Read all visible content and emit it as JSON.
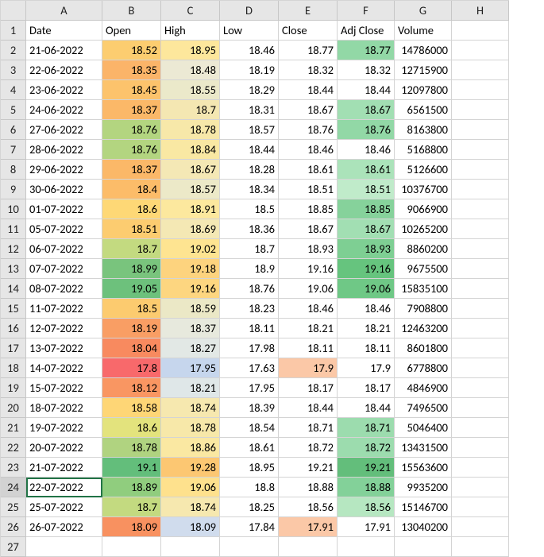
{
  "columns": [
    "A",
    "B",
    "C",
    "D",
    "E",
    "F",
    "G",
    "H"
  ],
  "row_count": 27,
  "selected_row_header": 24,
  "headers": {
    "date": "Date",
    "open": "Open",
    "high": "High",
    "low": "Low",
    "close": "Close",
    "adjclose": "Adj Close",
    "volume": "Volume"
  },
  "chart_data": {
    "type": "table",
    "title": "",
    "columns": [
      "Date",
      "Open",
      "High",
      "Low",
      "Close",
      "Adj Close",
      "Volume"
    ],
    "rows": [
      {
        "date": "21-06-2022",
        "open": 18.52,
        "open_bg": "#fccd70",
        "high": 18.95,
        "high_bg": "#fde79c",
        "low": 18.46,
        "close": 18.77,
        "adjclose": 18.77,
        "adj_bg": "#92d8a6",
        "volume": 14786000
      },
      {
        "date": "22-06-2022",
        "open": 18.35,
        "open_bg": "#fbb469",
        "high": 18.48,
        "high_bg": "#ece9d4",
        "low": 18.19,
        "close": 18.32,
        "adjclose": 18.32,
        "adj_bg": "#ffffff",
        "volume": 12715900
      },
      {
        "date": "23-06-2022",
        "open": 18.45,
        "open_bg": "#fcc36c",
        "high": 18.55,
        "high_bg": "#ebe9ca",
        "low": 18.29,
        "close": 18.44,
        "adjclose": 18.44,
        "adj_bg": "#ffffff",
        "volume": 12097800
      },
      {
        "date": "24-06-2022",
        "open": 18.37,
        "open_bg": "#fbb868",
        "high": 18.7,
        "high_bg": "#f4e7b2",
        "low": 18.31,
        "close": 18.67,
        "adjclose": 18.67,
        "adj_bg": "#a2dfb3",
        "volume": 6561500
      },
      {
        "date": "27-06-2022",
        "open": 18.76,
        "open_bg": "#b3d580",
        "high": 18.78,
        "high_bg": "#f7e8a9",
        "low": 18.57,
        "close": 18.76,
        "adjclose": 18.76,
        "adj_bg": "#92d8a6",
        "volume": 8163800
      },
      {
        "date": "28-06-2022",
        "open": 18.76,
        "open_bg": "#b3d580",
        "high": 18.84,
        "high_bg": "#f9e8a3",
        "low": 18.44,
        "close": 18.46,
        "adjclose": 18.46,
        "adj_bg": "#ffffff",
        "volume": 5168800
      },
      {
        "date": "29-06-2022",
        "open": 18.37,
        "open_bg": "#fbb868",
        "high": 18.67,
        "high_bg": "#f4e8b5",
        "low": 18.28,
        "close": 18.61,
        "adjclose": 18.61,
        "adj_bg": "#abe3ba",
        "volume": 5126600
      },
      {
        "date": "30-06-2022",
        "open": 18.4,
        "open_bg": "#fcbc69",
        "high": 18.57,
        "high_bg": "#ece9c8",
        "low": 18.34,
        "close": 18.51,
        "adjclose": 18.51,
        "adj_bg": "#c0ebca",
        "volume": 10376700
      },
      {
        "date": "01-07-2022",
        "open": 18.6,
        "open_bg": "#fed876",
        "high": 18.91,
        "high_bg": "#fce89e",
        "low": 18.5,
        "close": 18.85,
        "adjclose": 18.85,
        "adj_bg": "#86d29b",
        "volume": 9066900
      },
      {
        "date": "05-07-2022",
        "open": 18.51,
        "open_bg": "#fccc70",
        "high": 18.69,
        "high_bg": "#f4e8b4",
        "low": 18.36,
        "close": 18.67,
        "adjclose": 18.67,
        "adj_bg": "#a2dfb3",
        "volume": 10265200
      },
      {
        "date": "06-07-2022",
        "open": 18.7,
        "open_bg": "#c3da80",
        "high": 19.02,
        "high_bg": "#fee491",
        "low": 18.7,
        "close": 18.93,
        "adjclose": 18.93,
        "adj_bg": "#7ecf93",
        "volume": 8860200
      },
      {
        "date": "07-07-2022",
        "open": 18.99,
        "open_bg": "#79c47d",
        "high": 19.18,
        "high_bg": "#fdd37e",
        "low": 18.9,
        "close": 19.16,
        "adjclose": 19.16,
        "adj_bg": "#66c47e",
        "volume": 9675500
      },
      {
        "date": "08-07-2022",
        "open": 19.05,
        "open_bg": "#6dc17c",
        "high": 19.16,
        "high_bg": "#fdd680",
        "low": 18.76,
        "close": 19.06,
        "adjclose": 19.06,
        "adj_bg": "#6fc886",
        "volume": 15835100
      },
      {
        "date": "11-07-2022",
        "open": 18.5,
        "open_bg": "#fccb6f",
        "high": 18.59,
        "high_bg": "#ebe8c6",
        "low": 18.23,
        "close": 18.46,
        "adjclose": 18.46,
        "adj_bg": "#ffffff",
        "volume": 7908800
      },
      {
        "date": "12-07-2022",
        "open": 18.19,
        "open_bg": "#f99e64",
        "high": 18.37,
        "high_bg": "#e7e9dd",
        "low": 18.11,
        "close": 18.21,
        "adjclose": 18.21,
        "adj_bg": "#ffffff",
        "volume": 12463200
      },
      {
        "date": "13-07-2022",
        "open": 18.04,
        "open_bg": "#f88a5f",
        "high": 18.27,
        "high_bg": "#e2e8e5",
        "low": 17.98,
        "close": 18.11,
        "adjclose": 18.11,
        "adj_bg": "#ffffff",
        "volume": 8601800
      },
      {
        "date": "14-07-2022",
        "open": 17.8,
        "open_bg": "#f8696b",
        "high": 17.95,
        "high_bg": "#c6d6ed",
        "low": 17.63,
        "close": 17.9,
        "close_bg": "#fbc8a7",
        "adjclose": 17.9,
        "adj_bg": "#ffffff",
        "volume": 6778800
      },
      {
        "date": "15-07-2022",
        "open": 18.12,
        "open_bg": "#f99662",
        "high": 18.21,
        "high_bg": "#dfe7e8",
        "low": 17.95,
        "close": 18.17,
        "adjclose": 18.17,
        "adj_bg": "#ffffff",
        "volume": 4846900
      },
      {
        "date": "18-07-2022",
        "open": 18.58,
        "open_bg": "#fed676",
        "high": 18.74,
        "high_bg": "#f6e8af",
        "low": 18.39,
        "close": 18.44,
        "adjclose": 18.44,
        "adj_bg": "#ffffff",
        "volume": 7496500
      },
      {
        "date": "19-07-2022",
        "open": 18.6,
        "open_bg": "#e3e37d",
        "high": 18.78,
        "high_bg": "#f7e8a9",
        "low": 18.54,
        "close": 18.71,
        "adjclose": 18.71,
        "adj_bg": "#9cdcae",
        "volume": 5046400
      },
      {
        "date": "20-07-2022",
        "open": 18.78,
        "open_bg": "#b0d380",
        "high": 18.86,
        "high_bg": "#fae8a2",
        "low": 18.61,
        "close": 18.72,
        "adjclose": 18.72,
        "adj_bg": "#9cdcae",
        "volume": 13431500
      },
      {
        "date": "21-07-2022",
        "open": 19.1,
        "open_bg": "#63be7b",
        "high": 19.28,
        "high_bg": "#fcc772",
        "low": 18.95,
        "close": 19.21,
        "adjclose": 19.21,
        "adj_bg": "#63be7b",
        "volume": 15563600
      },
      {
        "date": "22-07-2022",
        "open": 18.89,
        "open_bg": "#90cd7e",
        "high": 19.06,
        "high_bg": "#fee18d",
        "low": 18.8,
        "close": 18.88,
        "adjclose": 18.88,
        "adj_bg": "#83d199",
        "volume": 9935200
      },
      {
        "date": "25-07-2022",
        "open": 18.7,
        "open_bg": "#c3da80",
        "high": 18.74,
        "high_bg": "#f6e8af",
        "low": 18.25,
        "close": 18.56,
        "adjclose": 18.56,
        "adj_bg": "#b6e7c1",
        "volume": 15146700
      },
      {
        "date": "26-07-2022",
        "open": 18.09,
        "open_bg": "#f89160",
        "high": 18.09,
        "high_bg": "#d0dced",
        "low": 17.84,
        "close": 17.91,
        "close_bg": "#fbc8a7",
        "adjclose": 17.91,
        "adj_bg": "#ffffff",
        "volume": 13040200
      }
    ]
  }
}
